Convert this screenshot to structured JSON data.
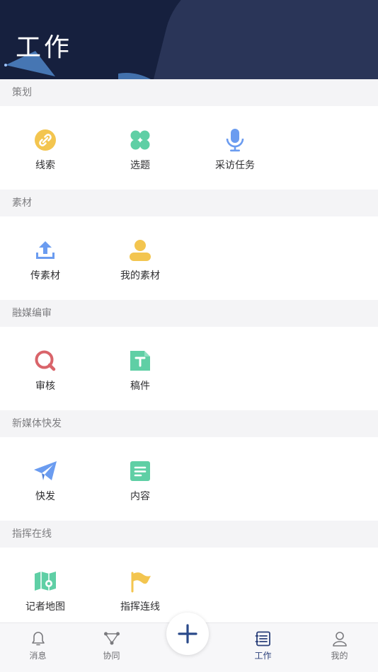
{
  "header": {
    "title": "工作"
  },
  "sections": [
    {
      "label": "策划",
      "items": [
        {
          "label": "线索",
          "icon": "link-icon",
          "color": "#f3c54f"
        },
        {
          "label": "选题",
          "icon": "clover-icon",
          "color": "#5fcfa5"
        },
        {
          "label": "采访任务",
          "icon": "microphone-icon",
          "color": "#6b9cf0"
        }
      ]
    },
    {
      "label": "素材",
      "items": [
        {
          "label": "传素材",
          "icon": "upload-icon",
          "color": "#6b9cf0"
        },
        {
          "label": "我的素材",
          "icon": "user-icon",
          "color": "#f3c54f"
        }
      ]
    },
    {
      "label": "融媒编审",
      "items": [
        {
          "label": "审核",
          "icon": "review-icon",
          "color": "#d9646a"
        },
        {
          "label": "稿件",
          "icon": "document-icon",
          "color": "#5fcfa5"
        }
      ]
    },
    {
      "label": "新媒体快发",
      "items": [
        {
          "label": "快发",
          "icon": "paper-plane-icon",
          "color": "#6b9cf0"
        },
        {
          "label": "内容",
          "icon": "content-icon",
          "color": "#5fcfa5"
        }
      ]
    },
    {
      "label": "指挥在线",
      "items": [
        {
          "label": "记者地图",
          "icon": "map-icon",
          "color": "#5fcfa5"
        },
        {
          "label": "指挥连线",
          "icon": "flag-icon",
          "color": "#f3c54f"
        }
      ]
    }
  ],
  "tabbar": [
    {
      "label": "消息",
      "icon": "bell-icon",
      "active": false
    },
    {
      "label": "协同",
      "icon": "collaborate-icon",
      "active": false
    },
    {
      "label": "工作",
      "icon": "work-icon",
      "active": true
    },
    {
      "label": "我的",
      "icon": "profile-icon",
      "active": false
    }
  ],
  "fab": {
    "icon": "plus-icon"
  },
  "colors": {
    "header": "#16203e",
    "accent": "#2a3f7a"
  }
}
